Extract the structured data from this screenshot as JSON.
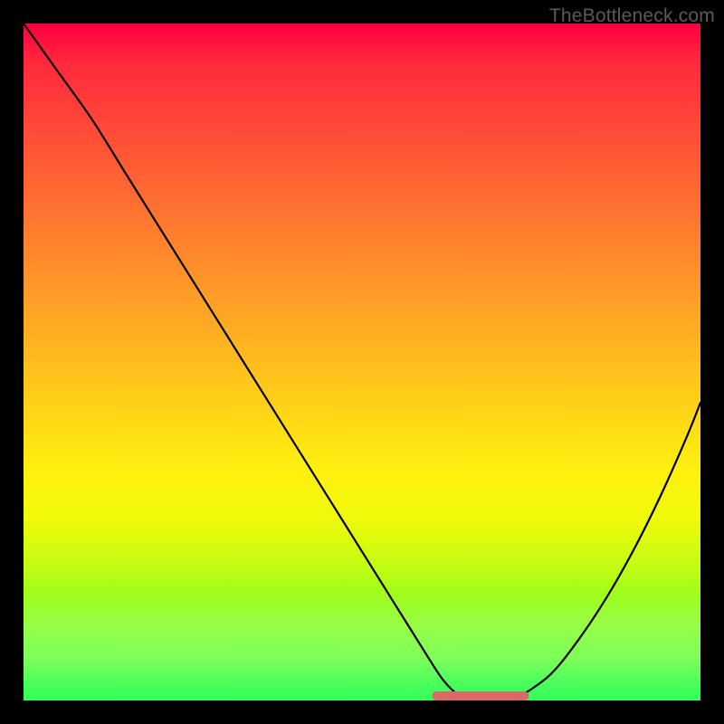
{
  "watermark": {
    "text": "TheBottleneck.com"
  },
  "chart_data": {
    "type": "line",
    "title": "",
    "xlabel": "",
    "ylabel": "",
    "xlim": [
      0,
      100
    ],
    "ylim": [
      0,
      100
    ],
    "x": [
      0,
      5,
      10,
      15,
      20,
      25,
      30,
      35,
      40,
      45,
      50,
      55,
      60,
      62,
      64,
      66,
      68,
      70,
      72,
      74,
      78,
      82,
      86,
      90,
      94,
      98,
      100
    ],
    "values": [
      100,
      93,
      86,
      78,
      70,
      62,
      54,
      46,
      38,
      30,
      22,
      14,
      6,
      3,
      1,
      0,
      0,
      0,
      0,
      1,
      4,
      9,
      15,
      22,
      30,
      39,
      44
    ],
    "highlight_segment": {
      "x_start": 61,
      "x_end": 74,
      "y": 0
    },
    "background_gradient": {
      "orientation": "vertical",
      "stops": [
        {
          "pos": 0.0,
          "color": "#ff0040"
        },
        {
          "pos": 0.18,
          "color": "#ff5236"
        },
        {
          "pos": 0.42,
          "color": "#ffa225"
        },
        {
          "pos": 0.66,
          "color": "#fff00f"
        },
        {
          "pos": 0.85,
          "color": "#98fd1c"
        },
        {
          "pos": 1.0,
          "color": "#00ff55"
        }
      ]
    }
  }
}
